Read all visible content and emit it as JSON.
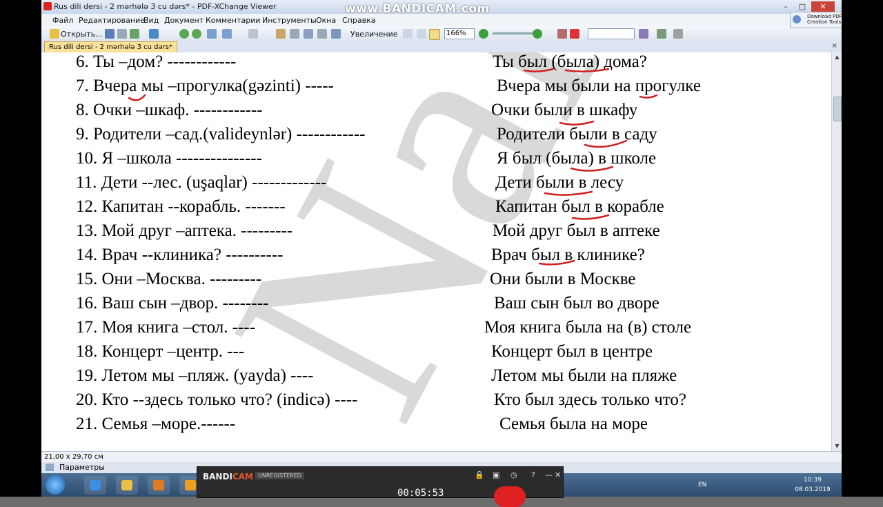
{
  "window": {
    "title": "Rus dili dersi  - 2 mərhələ 3 cu dərs* - PDF-XChange Viewer",
    "watermark_text": "www.BANDICAM.com",
    "controls": [
      "–",
      "□",
      "✕"
    ]
  },
  "menu": [
    "Файл",
    "Редактирование",
    "Вид",
    "Документ",
    "Комментарии",
    "Инструменты",
    "Окна",
    "Справка"
  ],
  "toolbar": {
    "open_label": "Открыть...",
    "zoom_label": "Увеличение",
    "zoom_value": "166%",
    "download_line1": "Download PDF",
    "download_line2": "Creation Tools"
  },
  "tab": {
    "label": "Rus dili dersi  - 2 mərhələ 3 cu dərs*",
    "close": "×"
  },
  "document": {
    "watermark": "Nal",
    "rows": [
      {
        "left": "6. Ты –дом?          ------------",
        "right": "Ты был (была) дома?"
      },
      {
        "left": "7. Вчера  мы –прогулка(gəzinti)  -----",
        "right": "Вчера мы были на прогулке"
      },
      {
        "left": "8. Очки –шкаф. ------------",
        "right": "Очки  были  в шкафу"
      },
      {
        "left": "9. Родители –сад.(valideynlər)  ------------",
        "right": "Родители были в саду"
      },
      {
        "left": "10. Я –школа ---------------",
        "right": "Я был (была)  в школе"
      },
      {
        "left": "11. Дети  --лес. (uşaqlar) -------------",
        "right": "Дети были в лесу"
      },
      {
        "left": "12. Капитан  --корабль. -------",
        "right": "Капитан был в корабле"
      },
      {
        "left": "13. Мой  друг –аптека. ---------",
        "right": "Мой друг был в аптеке"
      },
      {
        "left": "14. Врач  --клиника? ----------",
        "right": "Врач был в клинике?"
      },
      {
        "left": "15. Они –Москва.  ---------",
        "right": "Они были в Москве"
      },
      {
        "left": "16. Ваш сын –двор.  --------",
        "right": "Ваш сын был во дворе"
      },
      {
        "left": "17. Моя  книга –стол. ----",
        "right": "Моя книга была на (в) столе"
      },
      {
        "left": " 18. Концерт –центр.  ---",
        "right": "Концерт был в центре"
      },
      {
        "left": "19. Летом  мы –пляж. (yayda) ----",
        "right": "Летом мы были на пляже"
      },
      {
        "left": "20. Кто  --здесь  только что? (indicə) ----",
        "right": "Кто был здесь только что?"
      },
      {
        "left": "21. Семья –море.------",
        "right": "Семья была на море"
      }
    ]
  },
  "status": {
    "page_size": "21,00 x 29,70 см",
    "panel_label": "Параметры"
  },
  "bandicam": {
    "logo_a": "BANDI",
    "logo_b": "CAM",
    "unregistered": "UNREGISTERED",
    "timer": "00:05:53",
    "controls": [
      "🔒",
      "▣",
      "◷",
      "?",
      "—",
      "✕"
    ]
  },
  "taskbar": {
    "lang": "EN",
    "time": "10:39",
    "date": "08.03.2019"
  },
  "colors": {
    "accent_red": "#d11f1f",
    "tab_yellow": "#fbe29a"
  }
}
